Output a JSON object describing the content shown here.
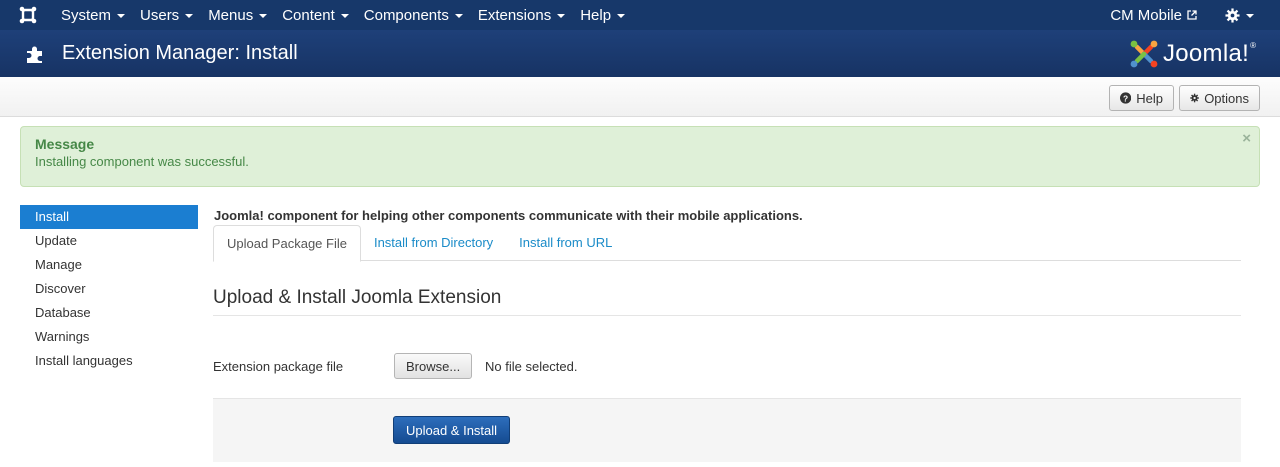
{
  "navbar": {
    "logo_icon": "joomla-icon",
    "menus": [
      {
        "label": "System"
      },
      {
        "label": "Users"
      },
      {
        "label": "Menus"
      },
      {
        "label": "Content"
      },
      {
        "label": "Components"
      },
      {
        "label": "Extensions"
      },
      {
        "label": "Help"
      }
    ],
    "site_name": "CM Mobile",
    "site_icon": "external-link-icon",
    "settings_icon": "gear-icon"
  },
  "header": {
    "title": "Extension Manager: Install",
    "title_icon": "puzzle-icon",
    "brand": "Joomla!",
    "brand_mark": "®"
  },
  "toolbar": {
    "help_label": "Help",
    "options_label": "Options"
  },
  "message": {
    "heading": "Message",
    "text": "Installing component was successful.",
    "close": "×"
  },
  "sidebar": {
    "items": [
      {
        "label": "Install",
        "active": true
      },
      {
        "label": "Update",
        "active": false
      },
      {
        "label": "Manage",
        "active": false
      },
      {
        "label": "Discover",
        "active": false
      },
      {
        "label": "Database",
        "active": false
      },
      {
        "label": "Warnings",
        "active": false
      },
      {
        "label": "Install languages",
        "active": false
      }
    ]
  },
  "main": {
    "description": "Joomla! component for helping other components communicate with their mobile applications.",
    "tabs": [
      {
        "label": "Upload Package File",
        "active": true
      },
      {
        "label": "Install from Directory",
        "active": false
      },
      {
        "label": "Install from URL",
        "active": false
      }
    ],
    "section_title": "Upload & Install Joomla Extension",
    "field_label": "Extension package file",
    "browse_label": "Browse...",
    "file_status": "No file selected.",
    "submit_label": "Upload & Install"
  },
  "colors": {
    "navbar_bg": "#17386a",
    "header_bg": "#1a3867",
    "active_blue": "#1b7ed1",
    "success_bg": "#dff0d8",
    "success_text": "#468847",
    "link": "#1a8bc8"
  }
}
